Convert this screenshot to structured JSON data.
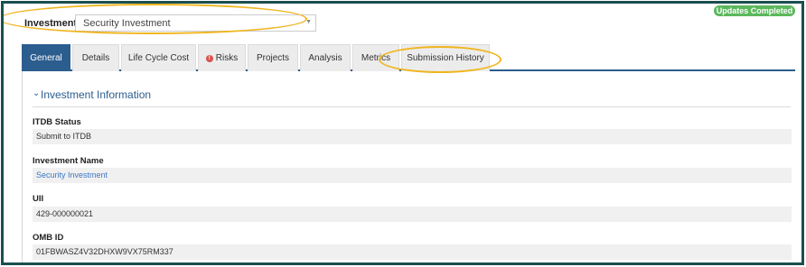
{
  "status_badge": "Updates Completed",
  "investment": {
    "label": "Investment",
    "selected": "Security Investment"
  },
  "tabs": [
    {
      "label": "General",
      "active": true
    },
    {
      "label": "Details"
    },
    {
      "label": "Life Cycle Cost"
    },
    {
      "label": "Risks",
      "icon": "alert-icon"
    },
    {
      "label": "Projects"
    },
    {
      "label": "Analysis"
    },
    {
      "label": "Metrics"
    },
    {
      "label": "Submission History"
    }
  ],
  "section": {
    "title": "Investment Information"
  },
  "fields": [
    {
      "label": "ITDB Status",
      "value": "Submit to ITDB"
    },
    {
      "label": "Investment Name",
      "value": "Security Investment"
    },
    {
      "label": "UII",
      "value": "429-000000021"
    },
    {
      "label": "OMB ID",
      "value": "01FBWASZ4V32DHXW9VX75RM337"
    }
  ],
  "colors": {
    "frame": "#1b4f4f",
    "accent": "#2b5d8e",
    "badge": "#5cb85c",
    "highlight": "#f0b51f",
    "link": "#3c78c3"
  }
}
